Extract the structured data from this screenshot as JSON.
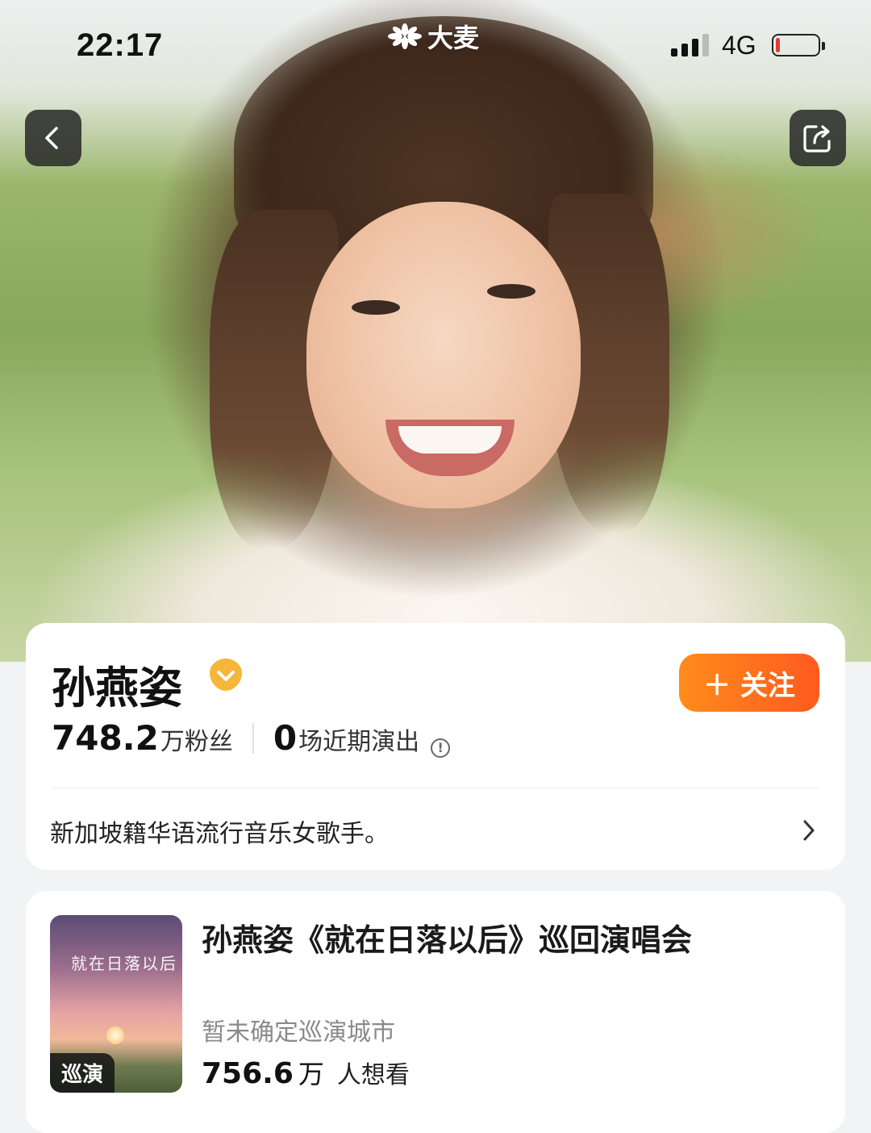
{
  "status_bar": {
    "time": "22:17",
    "brand": "大麦",
    "network": "4G",
    "battery_level": 0.1
  },
  "nav": {
    "back_icon": "chevron-left-icon",
    "share_icon": "share-icon"
  },
  "artist": {
    "name": "孙燕姿",
    "verified_icon": "verified-badge-icon",
    "follow_label": "＋ 关注",
    "fans_count": "748.2",
    "fans_label": "万粉丝",
    "shows_count": "0",
    "shows_label": "场近期演出",
    "bio": "新加坡籍华语流行音乐女歌手。"
  },
  "event": {
    "poster_title": "就在日落以后",
    "poster_tag": "巡演",
    "title": "孙燕姿《就在日落以后》巡回演唱会",
    "city": "暂未确定巡演城市",
    "want_count": "756.6",
    "want_unit": "万",
    "want_label": "人想看"
  },
  "colors": {
    "follow_gradient_start": "#ff8c1a",
    "follow_gradient_end": "#ff5a1f",
    "verified": "#f5b63a",
    "battery_low": "#e53935"
  }
}
